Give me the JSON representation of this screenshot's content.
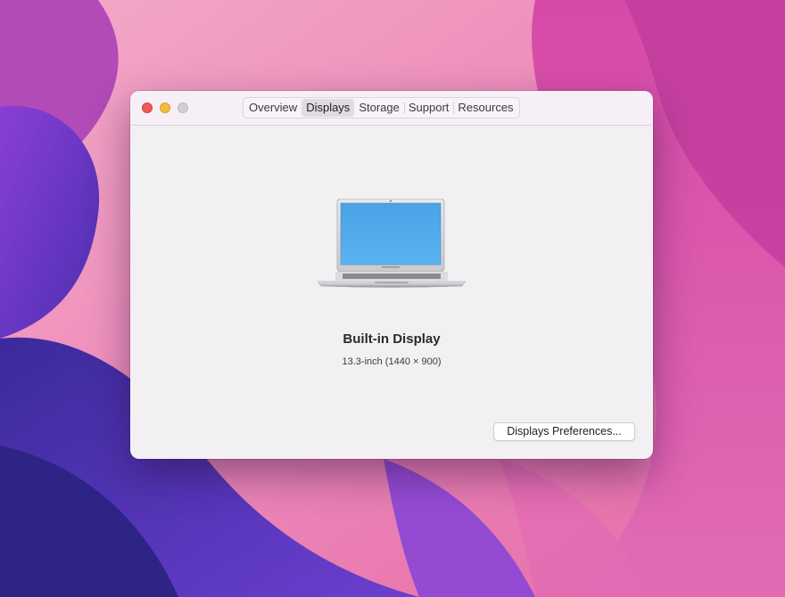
{
  "window": {
    "tabs": [
      {
        "label": "Overview"
      },
      {
        "label": "Displays"
      },
      {
        "label": "Storage"
      },
      {
        "label": "Support"
      },
      {
        "label": "Resources"
      }
    ],
    "selected_tab": "Displays"
  },
  "display": {
    "name": "Built-in Display",
    "details": "13.3-inch (1440 × 900)"
  },
  "actions": {
    "preferences_label": "Displays Preferences..."
  },
  "icons": {
    "close": "close-icon",
    "minimize": "minimize-icon",
    "zoom": "zoom-icon",
    "device": "laptop-icon"
  },
  "colors": {
    "close": "#ee5b54",
    "minimize": "#f4bd3b",
    "zoom_inactive": "#d2cfd3",
    "screen": "#4aa3e6"
  }
}
